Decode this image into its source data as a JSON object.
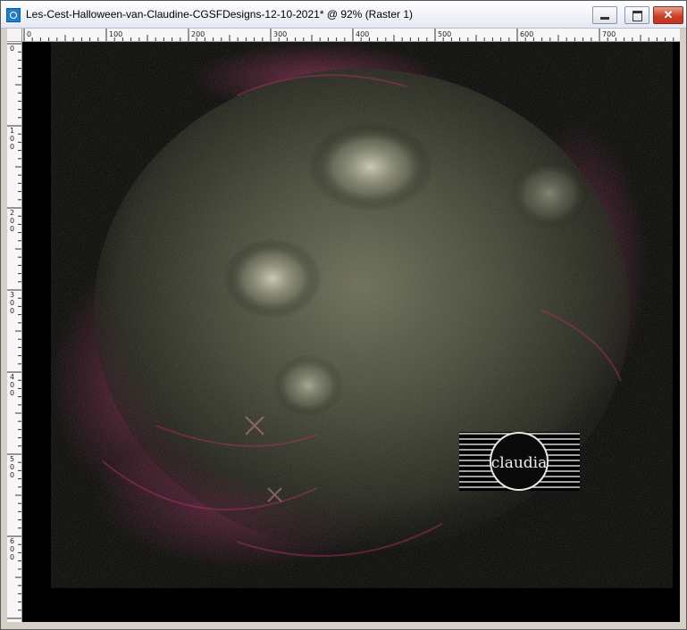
{
  "window": {
    "title": "Les-Cest-Halloween-van-Claudine-CGSFDesigns-12-10-2021* @  92% (Raster 1)",
    "controls": {
      "minimize": "minimize",
      "maximize": "maximize",
      "close": "close"
    }
  },
  "ruler": {
    "horizontal_labels": [
      "0",
      "100",
      "200",
      "300",
      "400",
      "500",
      "600",
      "700"
    ],
    "vertical_labels": [
      "0",
      "100",
      "200",
      "300",
      "400",
      "500",
      "600"
    ]
  },
  "canvas": {
    "zoom": "92%",
    "layer": "Raster 1",
    "background_color": "#000000",
    "texture_color": "#5a5c48",
    "accent_color": "#b0306a"
  },
  "watermark": {
    "text": "claudia"
  }
}
